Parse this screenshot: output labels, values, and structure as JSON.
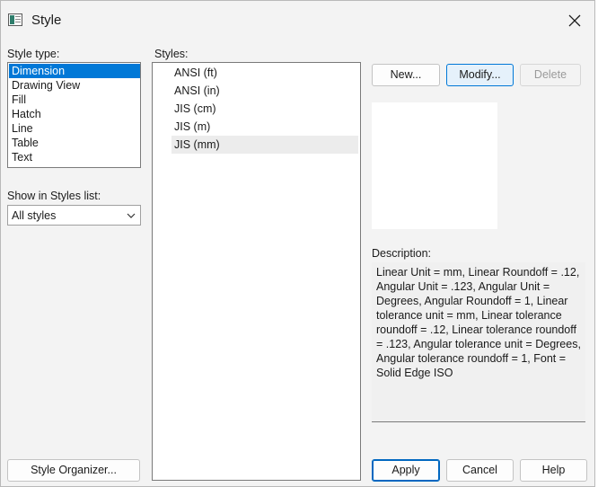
{
  "window": {
    "title": "Style"
  },
  "style_type": {
    "label": "Style type:",
    "items": [
      "Dimension",
      "Drawing View",
      "Fill",
      "Hatch",
      "Line",
      "Table",
      "Text"
    ],
    "selected": "Dimension"
  },
  "show_in_list": {
    "label": "Show in Styles list:",
    "value": "All styles"
  },
  "styles": {
    "label": "Styles:",
    "items": [
      "ANSI (ft)",
      "ANSI (in)",
      "JIS (cm)",
      "JIS (m)",
      "JIS (mm)"
    ],
    "highlighted": "JIS (mm)"
  },
  "buttons": {
    "new": "New...",
    "modify": "Modify...",
    "delete": "Delete",
    "style_organizer": "Style Organizer...",
    "apply": "Apply",
    "cancel": "Cancel",
    "help": "Help"
  },
  "description": {
    "label": "Description:",
    "text": "Linear Unit = mm, Linear Roundoff = .12, Angular Unit = .123, Angular Unit = Degrees, Angular Roundoff = 1, Linear tolerance unit = mm, Linear tolerance roundoff = .12, Linear tolerance roundoff = .123, Angular tolerance unit = Degrees, Angular tolerance roundoff = 1, Font = Solid Edge ISO"
  },
  "icons": {
    "title": "app-window-icon",
    "close": "close-icon",
    "dropdown": "chevron-down-icon"
  },
  "colors": {
    "selection": "#0078d7",
    "focus_border": "#0078d7",
    "dialog_bg": "#f3f3f3"
  }
}
